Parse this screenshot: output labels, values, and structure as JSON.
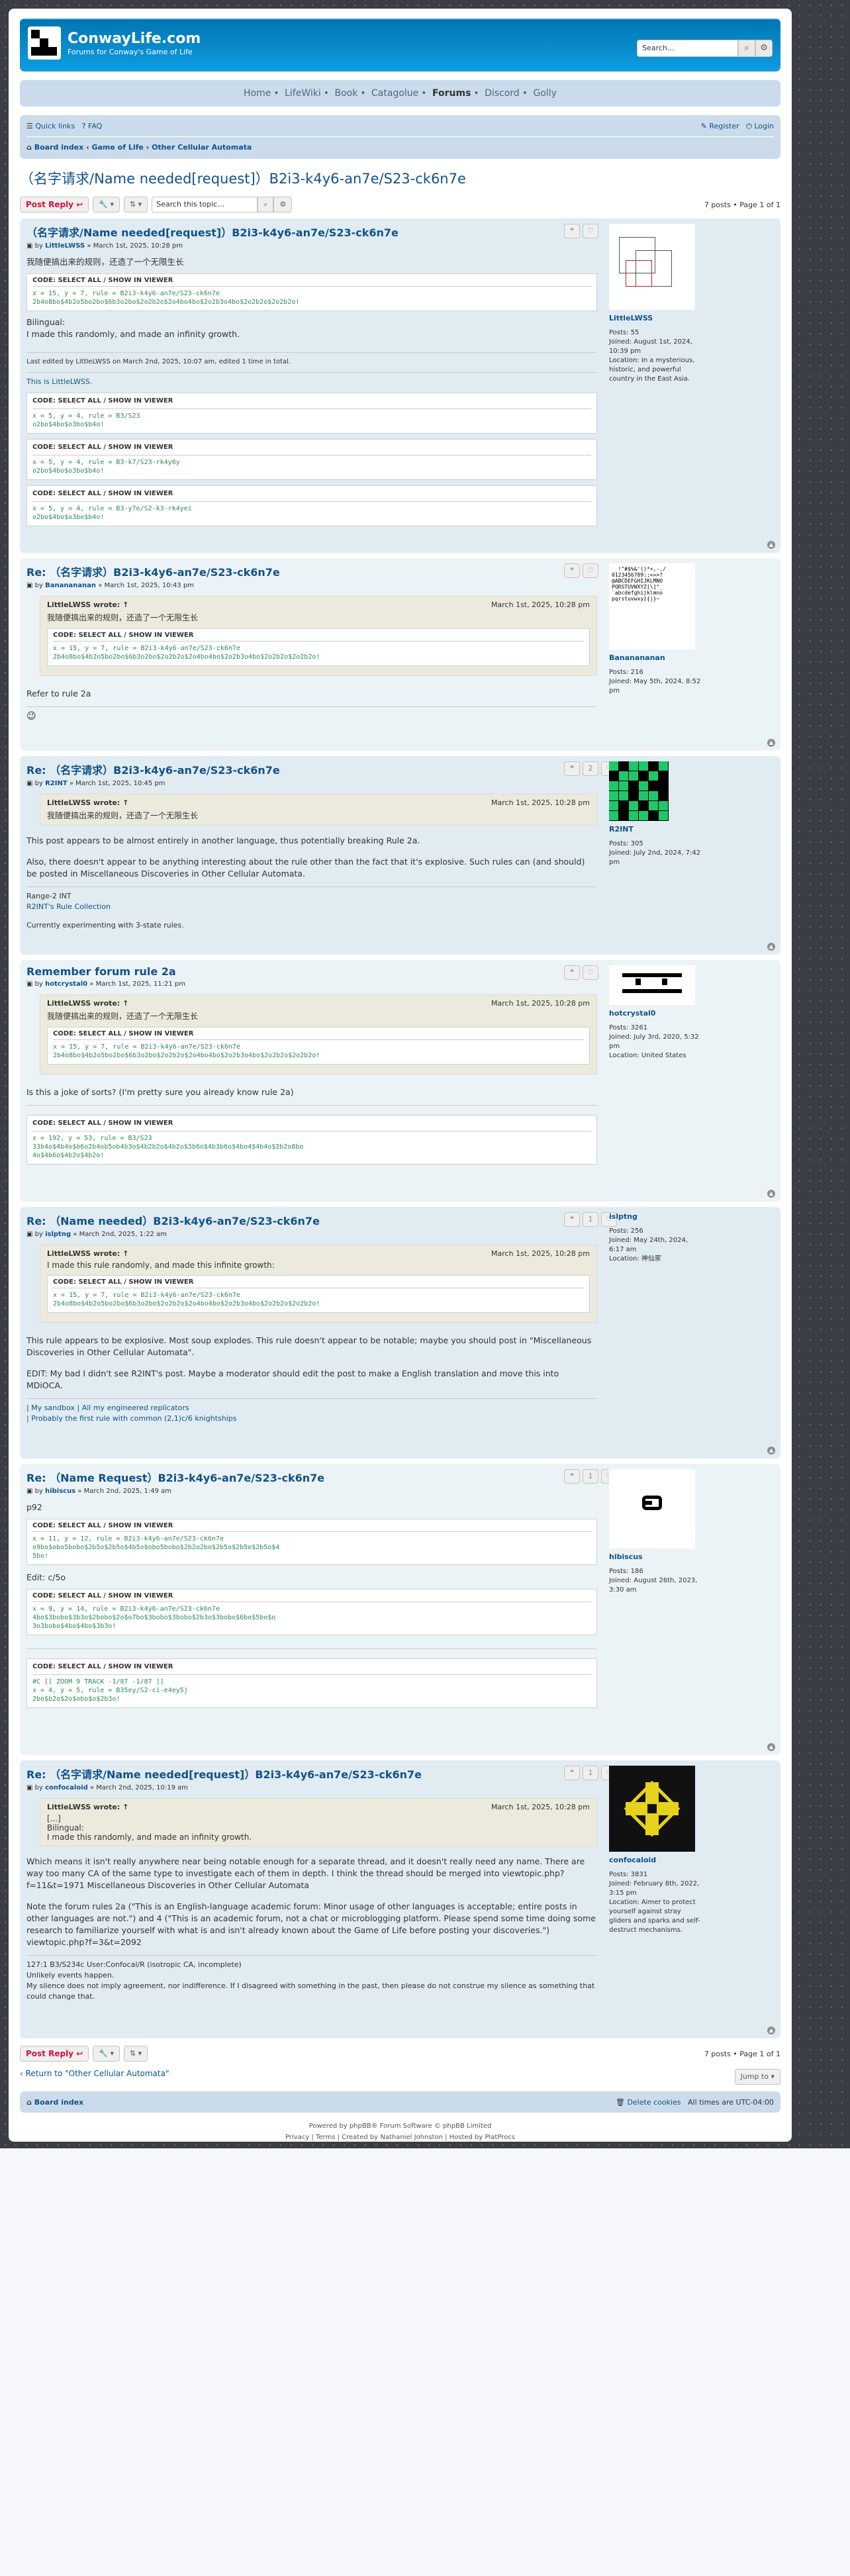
{
  "header": {
    "sitename": "ConwayLife.com",
    "description": "Forums for Conway's Game of Life",
    "search_placeholder": "Search…",
    "search_icon": "search-icon",
    "adv_icon": "gear-icon"
  },
  "nav": {
    "items": [
      "Home",
      "LifeWiki",
      "Book",
      "Catagolue",
      "Forums",
      "Discord",
      "Golly"
    ],
    "active": "Forums"
  },
  "breadcrumbs": {
    "quicklinks": "Quick links",
    "faq": "FAQ",
    "register": "Register",
    "login": "Login",
    "board_index": "Board index",
    "forum1": "Game of Life",
    "forum2": "Other Cellular Automata"
  },
  "topic": {
    "title": "（名字请求/Name needed[request]）B2i3-k4y6-an7e/S23-ck6n7e",
    "post_reply": "Post Reply",
    "search_placeholder": "Search this topic…",
    "pagination": "7 posts • Page 1 of 1"
  },
  "posts": [
    {
      "title": "（名字请求/Name needed[request]）B2i3-k4y6-an7e/S23-ck6n7e",
      "author": "LittleLWSS",
      "date": "March 1st, 2025, 10:28 pm",
      "text1": "我随便搞出来的规则，还造了一个无限生长",
      "code1": {
        "header": "CODE: SELECT ALL / SHOW IN VIEWER",
        "body": "x = 15, y = 7, rule = B2i3-k4y6-an7e/S23-ck6n7e\n2b4o8bo$4b2o5bo2bo$6b3o2bo$2o2b2o$2o4bo4bo$2o2b3o4bo$2o2b2o$2o2b2o!"
      },
      "bilingual": "Bilingual:",
      "text2": "I made this randomly, and made an infinity growth.",
      "edited": "Last edited by LittleLWSS on March 2nd, 2025, 10:07 am, edited 1 time in total.",
      "sigline": "This is LittleLWSS.",
      "sigcodes": [
        {
          "header": "CODE: SELECT ALL / SHOW IN VIEWER",
          "body": "x = 5, y = 4, rule = B3/S23\no2bo$4bo$o3bo$b4o!"
        },
        {
          "header": "CODE: SELECT ALL / SHOW IN VIEWER",
          "body": "x = 5, y = 4, rule = B3-k7/S23-rk4y6y\no2bo$4bo$o3bo$b4o!"
        },
        {
          "header": "CODE: SELECT ALL / SHOW IN VIEWER",
          "body": "x = 5, y = 4, rule = B3-y7e/S2-k3-rk4yei\no2bo$4bo$o3bo$b4o!"
        }
      ],
      "profile": {
        "name": "LittleLWSS",
        "posts": "Posts: 55",
        "joined": "Joined: August 1st, 2024, 10:39 pm",
        "location": "Location: In a mysterious, historic, and powerful country in the East Asia."
      }
    },
    {
      "title": "Re: （名字请求）B2i3-k4y6-an7e/S23-ck6n7e",
      "author": "Bananananan",
      "date": "March 1st, 2025, 10:43 pm",
      "quote": {
        "author": "LittleLWSS wrote: ↑",
        "date": "March 1st, 2025, 10:28 pm",
        "text": "我随便搞出来的规则，还造了一个无限生长",
        "code": {
          "header": "CODE: SELECT ALL / SHOW IN VIEWER",
          "body": "x = 15, y = 7, rule = B2i3-k4y6-an7e/S23-ck6n7e\n2b4o8bo$4b2o5bo2bo$6b3o2bo$2o2b2o$2o4bo4bo$2o2b3o4bo$2o2b2o$2o2b2o!"
        }
      },
      "text1": "Refer to rule 2a",
      "emoji": "😉",
      "profile": {
        "name": "Bananananan",
        "posts": "Posts: 216",
        "joined": "Joined: May 5th, 2024, 8:52 pm"
      }
    },
    {
      "title": "Re: （名字请求）B2i3-k4y6-an7e/S23-ck6n7e",
      "author": "R2INT",
      "date": "March 1st, 2025, 10:45 pm",
      "votes": "2",
      "quote": {
        "author": "LittleLWSS wrote: ↑",
        "date": "March 1st, 2025, 10:28 pm",
        "text": "我随便搞出来的规则，还造了一个无限生长"
      },
      "text1": "This post appears to be almost entirely in another language, thus potentially breaking Rule 2a.",
      "text2": "Also, there doesn't appear to be anything interesting about the rule other than the fact that it's explosive. Such rules can (and should) be posted in Miscellaneous Discoveries in Other Cellular Automata.",
      "sig1": "Range-2 INT",
      "sig2": "R2INT's Rule Collection",
      "sig3": "Currently experimenting with 3-state rules.",
      "profile": {
        "name": "R2INT",
        "posts": "Posts: 305",
        "joined": "Joined: July 2nd, 2024, 7:42 pm"
      }
    },
    {
      "title": "Remember forum rule 2a",
      "author": "hotcrystal0",
      "date": "March 1st, 2025, 11:21 pm",
      "quote": {
        "author": "LittleLWSS wrote: ↑",
        "date": "March 1st, 2025, 10:28 pm",
        "text": "我随便搞出来的规则，还造了一个无限生长",
        "code": {
          "header": "CODE: SELECT ALL / SHOW IN VIEWER",
          "body": "x = 15, y = 7, rule = B2i3-k4y6-an7e/S23-ck6n7e\n2b4o8bo$4b2o5bo2bo$6b3o2bo$2o2b2o$2o4bo4bo$2o2b3o4bo$2o2b2o$2o2b2o!"
        }
      },
      "text1": "Is this a joke of sorts? (I'm pretty sure you already know rule 2a)",
      "sigcode": {
        "header": "CODE: SELECT ALL / SHOW IN VIEWER",
        "body": "x = 192, y = 53, rule = B3/S23\n33b4o$4b4o$b6o2b4ob5ob4b3o$4b2b2o$4b2o$3b6o$4b3b6o$4bo4$4b4o$2b2o8bo\n4o$4b6o$4b2o$4b2o!"
      },
      "profile": {
        "name": "hotcrystal0",
        "posts": "Posts: 3261",
        "joined": "Joined: July 3rd, 2020, 5:32 pm",
        "location": "Location: United States"
      }
    },
    {
      "title": "Re: （Name needed）B2i3-k4y6-an7e/S23-ck6n7e",
      "author": "islptng",
      "date": "March 2nd, 2025, 1:22 am",
      "votes": "1",
      "quote": {
        "author": "LittleLWSS wrote: ↑",
        "date": "March 1st, 2025, 10:28 pm",
        "text": "I made this rule randomly, and made this infinite growth:",
        "code": {
          "header": "CODE: SELECT ALL / SHOW IN VIEWER",
          "body": "x = 15, y = 7, rule = B2i3-k4y6-an7e/S23-ck6n7e\n2b4o8bo$4b2o5bo2bo$6b3o2bo$2o2b2o$2o4bo4bo$2o2b3o4bo$2o2b2o$2o2b2o!"
        }
      },
      "text1": "This rule appears to be explosive. Most soup explodes. This rule doesn't appear to be notable; maybe you should post in \"Miscellaneous Discoveries in Other Cellular Automata\".",
      "text2": "EDIT: My bad I didn't see R2INT's post. Maybe a moderator should edit the post to make a English translation and move this into MDiOCA.",
      "sig1": "| My sandbox | All my engineered replicators",
      "sig2": "| Probably the first rule with common (2,1)c/6 knightships",
      "profile": {
        "name": "islptng",
        "posts": "Posts: 256",
        "joined": "Joined: May 24th, 2024, 6:17 am",
        "location": "Location: 神仙家"
      }
    },
    {
      "title": "Re: （Name Request）B2i3-k4y6-an7e/S23-ck6n7e",
      "author": "hibiscus",
      "date": "March 2nd, 2025, 1:49 am",
      "votes": "1",
      "text1": "p92",
      "code1": {
        "header": "CODE: SELECT ALL / SHOW IN VIEWER",
        "body": "x = 11, y = 12, rule = B2i3-k4y6-an7e/S23-ck6n7e\no9bo$obo5bobo$2b5o$2b5o$4b5o$obo5bobo$2b2o2bo$2b5o$2b5o$2b5o$4\n5bo!"
      },
      "text2": "Edit: c/5o",
      "code2": {
        "header": "CODE: SELECT ALL / SHOW IN VIEWER",
        "body": "x = 9, y = 14, rule = B2i3-k4y6-an7e/S23-ck6n7e\n4bo$3bobo$3b3o$2bobo$2o$o7bo$3bobo$3bobo$2b3o$3bobo$6bo$5bo$o\n3o3bobo$4bo$4bo$3b3o!"
      },
      "sigcode": {
        "header": "CODE: SELECT ALL / SHOW IN VIEWER",
        "body": "#C [[ ZOOM 9 TRACK -1/87 -1/87 ]]\nx = 4, y = 5, rule = B35ey/S2-ci-e4ey5j\n2bo$b2o$2o$obo$o$2b3o!"
      },
      "profile": {
        "name": "hibiscus",
        "posts": "Posts: 186",
        "joined": "Joined: August 26th, 2023, 3:30 am"
      }
    },
    {
      "title": "Re: （名字请求/Name needed[request]）B2i3-k4y6-an7e/S23-ck6n7e",
      "author": "confocaloid",
      "date": "March 2nd, 2025, 10:19 am",
      "votes": "1",
      "quote": {
        "author": "LittleLWSS wrote: ↑",
        "date": "March 1st, 2025, 10:28 pm",
        "text": "[...]",
        "text2": "Bilingual:",
        "text3": "I made this randomly, and made an infinity growth."
      },
      "text1": "Which means it isn't really anywhere near being notable enough for a separate thread, and it doesn't really need any name. There are way too many CA of the same type to investigate each of them in depth. I think the thread should be merged into viewtopic.php?f=11&t=1971 Miscellaneous Discoveries in Other Cellular Automata",
      "text2": "Note the forum rules 2a (\"This is an English-language academic forum: Minor usage of other languages is acceptable; entire posts in other languages are not.\") and 4 (\"This is an academic forum, not a chat or microblogging platform. Please spend some time doing some research to familiarize yourself with what is and isn't already known about the Game of Life before posting your discoveries.\") viewtopic.php?f=3&t=2092",
      "sig1": "127:1 B3/S234c User:Confocal/R (isotropic CA, incomplete)",
      "sig2": "Unlikely events happen.",
      "sig3": "My silence does not imply agreement, nor indifference. If I disagreed with something in the past, then please do not construe my silence as something that could change that.",
      "profile": {
        "name": "confocaloid",
        "posts": "Posts: 3831",
        "joined": "Joined: February 8th, 2022, 3:15 pm",
        "location": "Location: Aimer to protect yourself against stray gliders and sparks and self-destruct mechanisms."
      }
    }
  ],
  "bottom": {
    "post_reply": "Post Reply",
    "pagination": "7 posts • Page 1 of 1",
    "return": "Return to \"Other Cellular Automata\"",
    "jump": "Jump to"
  },
  "footer": {
    "board_index": "Board index",
    "delete_cookies": "Delete cookies",
    "timezone": "All times are UTC-04:00",
    "powered": "Powered by phpBB® Forum Software © phpBB Limited",
    "links": "Privacy | Terms | Created by Nathaniel Johnston | Hosted by PlatProcs"
  }
}
